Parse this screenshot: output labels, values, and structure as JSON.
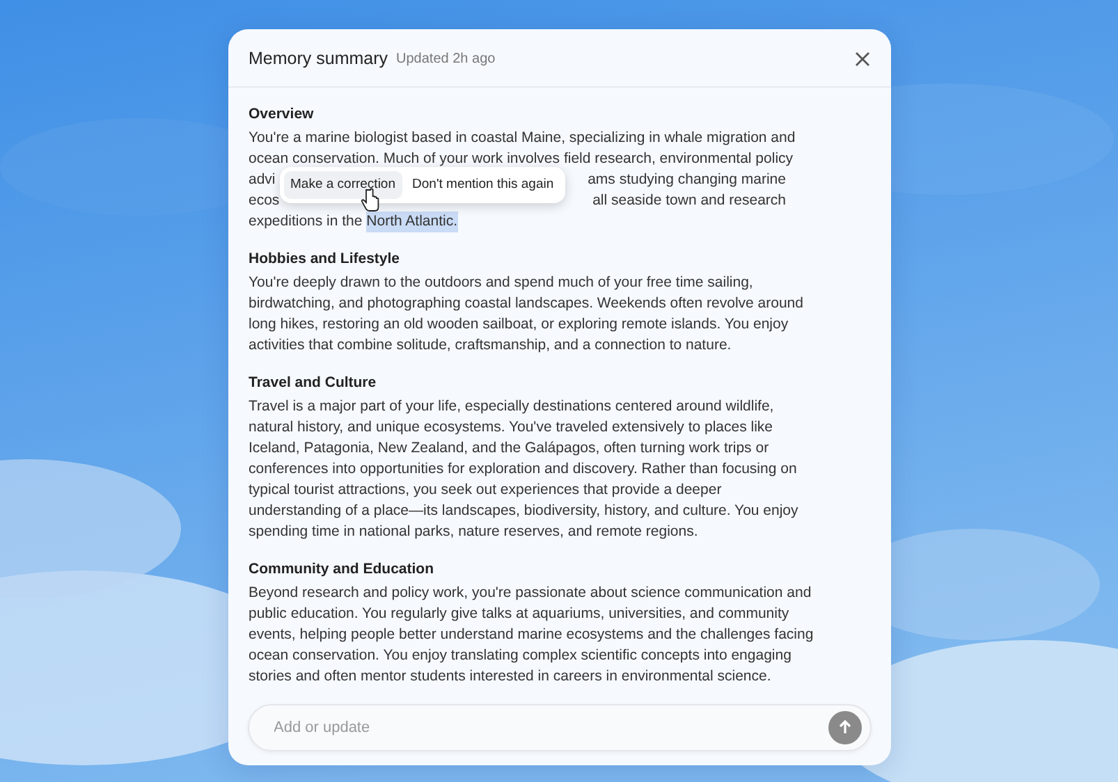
{
  "dialog": {
    "title": "Memory summary",
    "updated": "Updated 2h ago"
  },
  "sections": [
    {
      "heading": "Overview",
      "lines": [
        {
          "text": "You're a marine biologist based in coastal Maine, specializing in whale migration and"
        },
        {
          "text": "ocean conservation. Much of your work involves field research, environmental policy"
        },
        {
          "text": "advi",
          "after": "ams studying changing marine"
        },
        {
          "text": "ecos",
          "after": "all seaside town and research"
        },
        {
          "text": "expeditions in the ",
          "highlight": "North Atlantic."
        }
      ]
    },
    {
      "heading": "Hobbies and Lifestyle",
      "lines": [
        {
          "text": "You're deeply drawn to the outdoors and spend much of your free time sailing,"
        },
        {
          "text": "birdwatching, and photographing coastal landscapes. Weekends often revolve around"
        },
        {
          "text": "long hikes, restoring an old wooden sailboat, or exploring remote islands. You enjoy"
        },
        {
          "text": "activities that combine solitude, craftsmanship, and a connection to nature."
        }
      ]
    },
    {
      "heading": "Travel and Culture",
      "lines": [
        {
          "text": "Travel is a major part of your life, especially destinations centered around wildlife,"
        },
        {
          "text": "natural history, and unique ecosystems. You've traveled extensively to places like"
        },
        {
          "text": "Iceland, Patagonia, New Zealand, and the Galápagos, often turning work trips or"
        },
        {
          "text": "conferences into opportunities for exploration and discovery. Rather than focusing on"
        },
        {
          "text": "typical tourist attractions, you seek out experiences that provide a deeper"
        },
        {
          "text": "understanding of a place—its landscapes, biodiversity, history, and culture. You enjoy"
        },
        {
          "text": "spending time in national parks, nature reserves, and remote regions."
        }
      ]
    },
    {
      "heading": "Community and Education",
      "lines": [
        {
          "text": "Beyond research and policy work, you're passionate about science communication and"
        },
        {
          "text": "public education. You regularly give talks at aquariums, universities, and community"
        },
        {
          "text": "events, helping people better understand marine ecosystems and the challenges facing"
        },
        {
          "text": "ocean conservation. You enjoy translating complex scientific concepts into engaging"
        },
        {
          "text": "stories and often mentor students interested in careers in environmental science."
        }
      ]
    }
  ],
  "popup": {
    "actions": [
      {
        "label": "Make a correction",
        "hovered": true
      },
      {
        "label": "Don't mention this again",
        "hovered": false
      }
    ]
  },
  "input": {
    "placeholder": "Add or update"
  }
}
